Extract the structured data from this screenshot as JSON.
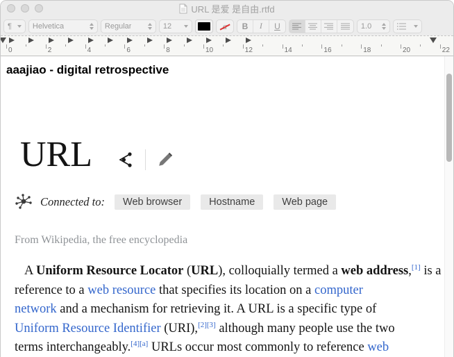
{
  "window": {
    "title": "URL 是爱 是自由.rtfd",
    "controls": [
      "close",
      "minimize",
      "zoom"
    ]
  },
  "toolbar": {
    "paragraph_styles_glyph": "¶",
    "font_family": "Helvetica",
    "font_style": "Regular",
    "font_size": "12",
    "text_color_swatch": "#000000",
    "highlight_glyph": "a",
    "bold_label": "B",
    "italic_label": "I",
    "underline_label": "U",
    "line_spacing": "1.0"
  },
  "ruler": {
    "unit_labels": [
      "0",
      "2",
      "4",
      "6",
      "8",
      "10",
      "12",
      "14",
      "16",
      "18",
      "20",
      "22"
    ],
    "minor_ticks_per_label": 1,
    "tab_stop_count": 13
  },
  "document": {
    "header": "aaajiao - digital retrospective",
    "article": {
      "title": "URL",
      "icons": [
        "share-graph-icon",
        "pencil-edit-icon",
        "network-node-icon"
      ],
      "connected_label": "Connected to:",
      "tags": [
        "Web browser",
        "Hostname",
        "Web page"
      ],
      "subtitle": "From Wikipedia, the free encyclopedia",
      "paragraph_lines": [
        [
          {
            "t": "A "
          },
          {
            "t": "Uniform Resource Locator",
            "b": true
          },
          {
            "t": " ("
          },
          {
            "t": "URL",
            "b": true
          },
          {
            "t": "), colloquially termed a "
          },
          {
            "t": "web address",
            "b": true
          },
          {
            "t": ","
          },
          {
            "t": "[1]",
            "l": true,
            "s": true
          },
          {
            "t": " is a"
          }
        ],
        [
          {
            "t": "reference to a "
          },
          {
            "t": "web resource",
            "l": true
          },
          {
            "t": " that specifies its location on a "
          },
          {
            "t": "computer",
            "l": true
          }
        ],
        [
          {
            "t": "network",
            "l": true
          },
          {
            "t": " and a mechanism for retrieving it. A URL is a specific type of"
          }
        ],
        [
          {
            "t": "Uniform Resource Identifier",
            "l": true
          },
          {
            "t": " (URI),"
          },
          {
            "t": "[2][3]",
            "l": true,
            "s": true
          },
          {
            "t": " although many people use the two"
          }
        ],
        [
          {
            "t": "terms interchangeably."
          },
          {
            "t": "[4][a]",
            "l": true,
            "s": true
          },
          {
            "t": " URLs occur most commonly to reference "
          },
          {
            "t": "web",
            "l": true
          }
        ]
      ]
    }
  },
  "colors": {
    "link": "#3366cc",
    "body_text": "#141414",
    "subtitle_text": "#8f9397",
    "tag_background": "#e9e9e9"
  }
}
